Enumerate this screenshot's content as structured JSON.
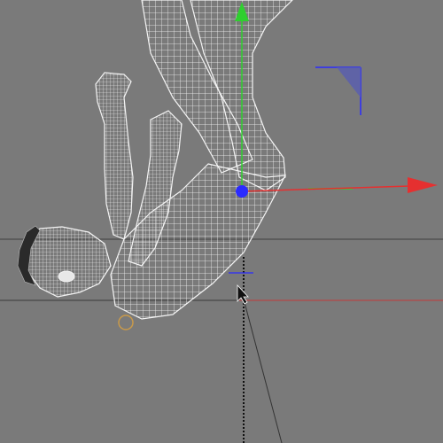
{
  "viewport": {
    "view": "3d-viewport",
    "background": "#7a7a7a"
  },
  "scene_object": {
    "name": "human-figure-mesh",
    "display": "wireframe",
    "pose": "upside-down",
    "wire_color": "#f2f2f2"
  },
  "gizmo": {
    "type": "move",
    "axis_colors": {
      "x": "#e53030",
      "y": "#2fcf2f",
      "z": "#2b2bff"
    }
  },
  "guides": {
    "horizontal_line_color": "#3a3a3a",
    "selected_line_color": "#c23a3a",
    "vertical_line_color": "#111111"
  },
  "cursor": {
    "icon": "arrow-cursor-icon"
  }
}
